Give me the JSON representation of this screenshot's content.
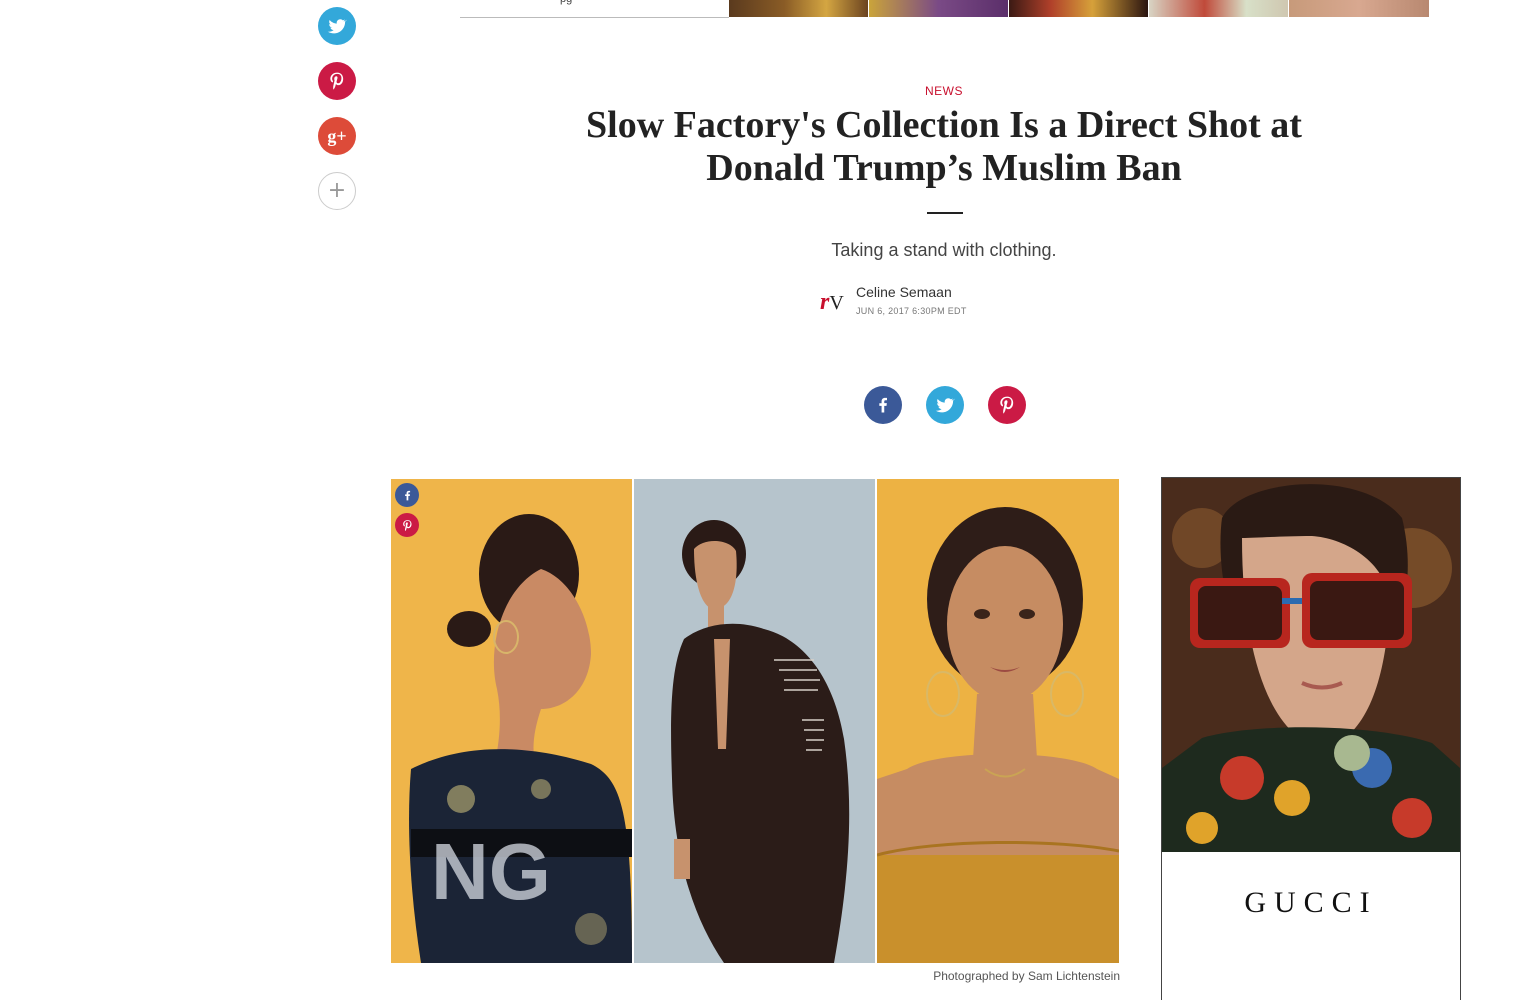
{
  "top_strip": {
    "partial_text": "pg"
  },
  "left_share": {
    "twitter": "twitter-icon",
    "pinterest": "pinterest-icon",
    "googleplus_label": "g+",
    "more_label": "+"
  },
  "article": {
    "kicker": "NEWS",
    "headline": "Slow Factory's Collection Is a Direct Shot at Donald Trump’s Muslim Ban",
    "dek": "Taking a stand with clothing.",
    "author": "Celine Semaan",
    "date": "JUN 6, 2017 6:30PM EDT",
    "logo_r": "r",
    "logo_v": "V",
    "photo_credit": "Photographed by Sam Lichtenstein"
  },
  "ad": {
    "brand": "GUCCI"
  },
  "colors": {
    "facebook": "#3b5998",
    "twitter": "#33a8da",
    "pinterest": "#cb1a45",
    "googleplus": "#dd4b39",
    "accent_red": "#c8102e"
  }
}
